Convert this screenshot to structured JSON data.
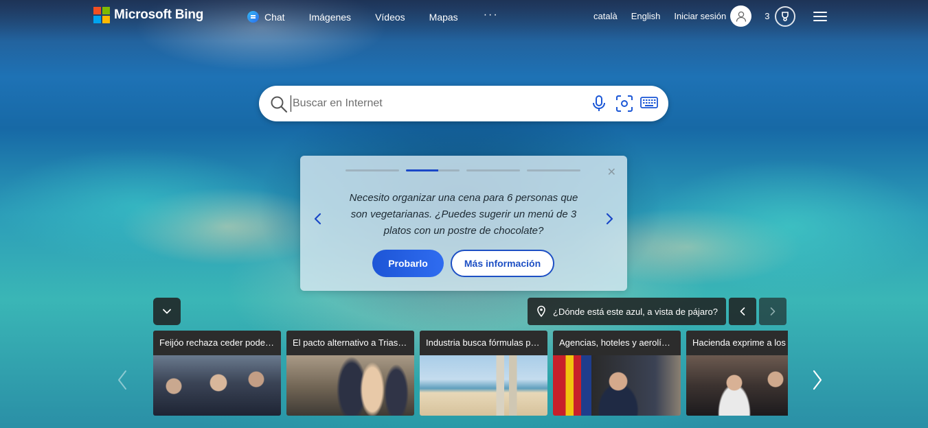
{
  "header": {
    "logo_text": "Microsoft Bing",
    "nav": [
      {
        "label": "Chat",
        "icon": "chat-icon"
      },
      {
        "label": "Imágenes"
      },
      {
        "label": "Vídeos"
      },
      {
        "label": "Mapas"
      }
    ],
    "more_label": "···",
    "languages": [
      "català",
      "English"
    ],
    "signin_label": "Iniciar sesión",
    "points": "3"
  },
  "search": {
    "placeholder": "Buscar en Internet"
  },
  "suggestion": {
    "text": "Necesito organizar una cena para 6 personas que son vegetarianas. ¿Puedes sugerir un menú de 3 platos con un postre de chocolate?",
    "primary_button": "Probarlo",
    "secondary_button": "Más información",
    "close_label": "✕",
    "progress_steps": 4,
    "active_step": 2,
    "active_step_progress": 0.6
  },
  "image_info": {
    "caption": "¿Dónde está este azul, a vista de pájaro?"
  },
  "news": [
    {
      "title": "Feijóo rechaza ceder poder a Junts"
    },
    {
      "title": "El pacto alternativo a Trias en Barcelona"
    },
    {
      "title": "Industria busca fórmulas para el turismo"
    },
    {
      "title": "Agencias, hoteles y aerolíneas"
    },
    {
      "title": "Hacienda exprime a los contribuyentes"
    }
  ],
  "colors": {
    "accent": "#1d55d6",
    "brand_red": "#f25022",
    "brand_green": "#7fba00",
    "brand_blue": "#00a4ef",
    "brand_yellow": "#ffb900"
  }
}
